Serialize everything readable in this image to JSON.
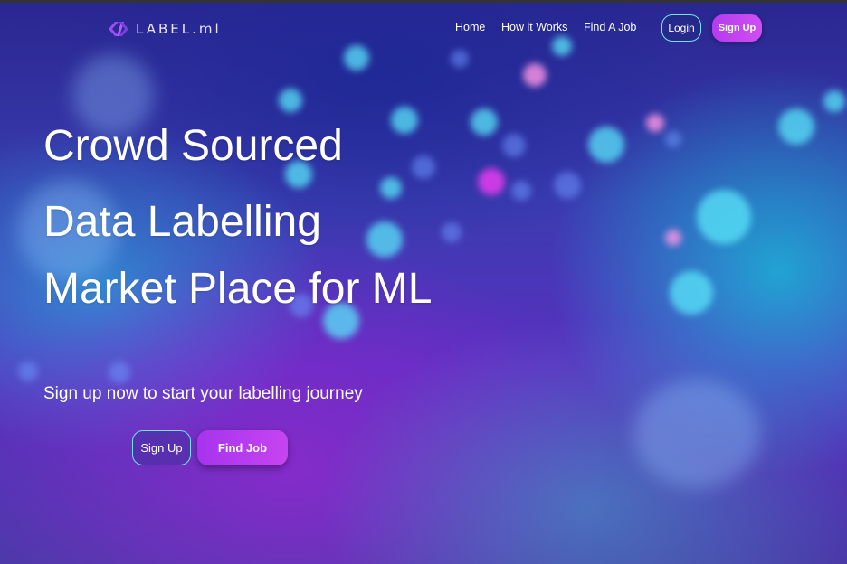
{
  "nav": {
    "logo_text": "LABEL.ml",
    "links": [
      {
        "label": "Home"
      },
      {
        "label": "How it Works"
      },
      {
        "label": "Find A Job"
      }
    ],
    "login_label": "Login",
    "signup_label": "Sign Up"
  },
  "hero": {
    "title_lines": [
      "Crowd Sourced",
      "Data Labelling",
      "Market Place for ML"
    ],
    "subtitle": "Sign up now to start your labelling journey",
    "signup_label": "Sign Up",
    "find_job_label": "Find Job"
  },
  "colors": {
    "accent_purple": "#c744f0",
    "accent_cyan": "#6ee6f0",
    "background_deep": "#2a2690"
  }
}
